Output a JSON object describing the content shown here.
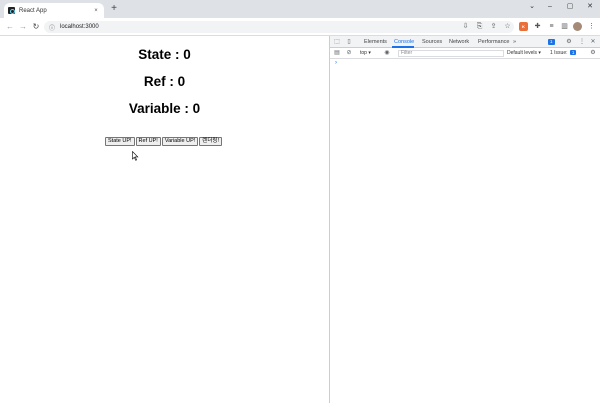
{
  "browser": {
    "tab_title": "React App",
    "tab_close": "×",
    "new_tab": "+",
    "window_controls": {
      "minimize": "–",
      "restore": "▢",
      "close": "✕",
      "chevron": "⌄"
    },
    "url": "localhost:3000"
  },
  "page": {
    "state_text": "State : 0",
    "ref_text": "Ref : 0",
    "variable_text": "Variable : 0",
    "buttons": {
      "state_up": "State UP!",
      "ref_up": "Ref UP!",
      "variable_up": "Variable UP!",
      "print": "렌더링!"
    }
  },
  "devtools": {
    "tabs": [
      "Elements",
      "Console",
      "Sources",
      "Network",
      "Performance"
    ],
    "more_tabs": "»",
    "issues_badge": "1",
    "context": "top ▾",
    "filter_placeholder": "Filter",
    "levels": "Default levels ▾",
    "issues_label": "1 Issue:",
    "issues_count": "1",
    "prompt": "›"
  },
  "colors": {
    "accent": "#1a73e8",
    "tabbar": "#dee1e6"
  }
}
